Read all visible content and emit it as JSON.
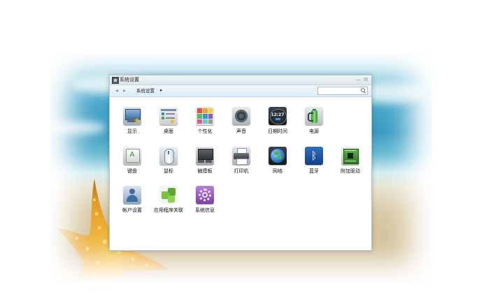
{
  "window": {
    "title": "系统设置",
    "minimize_symbol": "—",
    "close_symbol": "☒"
  },
  "toolbar": {
    "back_symbol": "◂",
    "forward_symbol": "▸",
    "breadcrumb": "系统设置",
    "breadcrumb_arrow": "▸",
    "search_value": "",
    "search_placeholder": ""
  },
  "items": [
    {
      "label": "显示",
      "icon": "display-icon"
    },
    {
      "label": "桌面",
      "icon": "desktop-icon"
    },
    {
      "label": "个性化",
      "icon": "personalization-icon"
    },
    {
      "label": "声音",
      "icon": "sound-icon"
    },
    {
      "label": "日期时间",
      "icon": "datetime-icon",
      "icon_text": "12:27"
    },
    {
      "label": "电源",
      "icon": "power-icon"
    },
    {
      "label": "键盘",
      "icon": "keyboard-icon",
      "icon_text": "A"
    },
    {
      "label": "鼠标",
      "icon": "mouse-icon"
    },
    {
      "label": "触摸板",
      "icon": "touchpad-icon"
    },
    {
      "label": "打印机",
      "icon": "printer-icon"
    },
    {
      "label": "网络",
      "icon": "network-icon"
    },
    {
      "label": "蓝牙",
      "icon": "bluetooth-icon",
      "icon_text": "ᛒ"
    },
    {
      "label": "附加驱动",
      "icon": "driver-icon"
    },
    {
      "label": "帐户设置",
      "icon": "account-icon"
    },
    {
      "label": "应用程序关联",
      "icon": "app-association-icon"
    },
    {
      "label": "系统信息",
      "icon": "system-info-icon"
    }
  ],
  "colors": {
    "toolbar_bg": "#dcedf7",
    "window_border": "#b6c4cf"
  }
}
